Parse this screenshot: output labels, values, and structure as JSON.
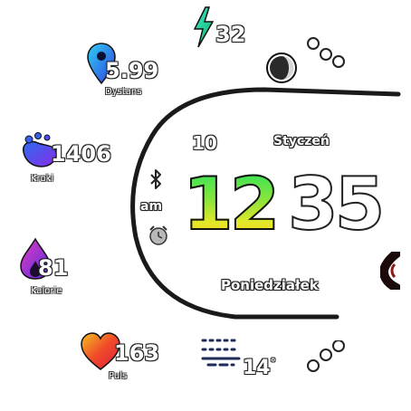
{
  "time": {
    "hour": "12",
    "minute": "35",
    "ampm": "am"
  },
  "date": {
    "day": "10",
    "month": "Styczeń",
    "weekday": "Poniedziałek"
  },
  "metrics": {
    "battery": {
      "value": "32",
      "icon": "lightning-bolt-icon"
    },
    "distance": {
      "value": "5.99",
      "label": "Dystans",
      "icon": "map-pin-icon"
    },
    "steps": {
      "value": "1406",
      "label": "Kroki",
      "icon": "footprints-icon"
    },
    "calories": {
      "value": "81",
      "label": "Kalorie",
      "icon": "flame-icon"
    },
    "heart": {
      "value": "163",
      "label": "Puls",
      "icon": "heart-icon"
    },
    "weather": {
      "value": "14",
      "unit": "°",
      "icon": "fog-icon"
    }
  },
  "status": {
    "bluetooth_icon": "bluetooth-icon",
    "alarm_icon": "alarm-clock-icon",
    "moon_icon": "moon-phase-icon"
  },
  "colors": {
    "hour_top": "#2fe35a",
    "hour_bottom": "#f3d21b",
    "arc": "#1a1a1a",
    "battery": "#22d6a6",
    "distance": "#3a6cf0",
    "steps": "#6a3cf0",
    "calories": "#c23ccf",
    "heart": "#f0382a"
  }
}
